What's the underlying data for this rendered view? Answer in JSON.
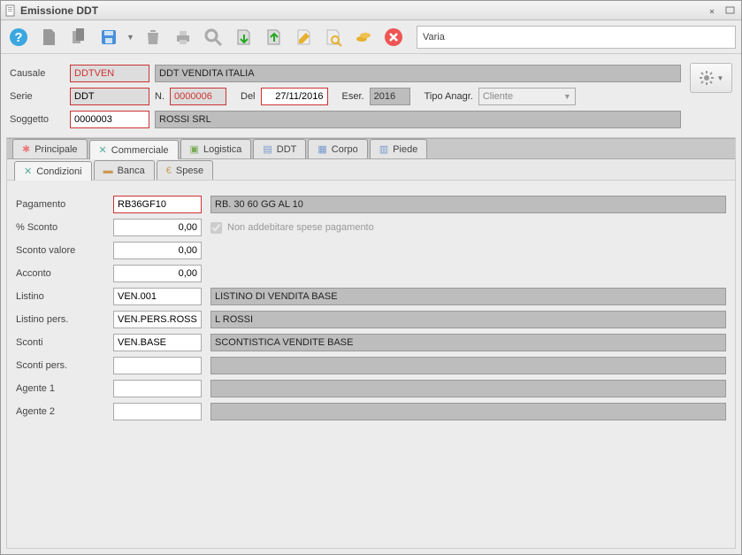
{
  "window": {
    "title": "Emissione DDT"
  },
  "toolbar": {
    "right_text": "Varia"
  },
  "header": {
    "causale_label": "Causale",
    "causale_value": "DDTVEN",
    "causale_desc": "DDT VENDITA ITALIA",
    "serie_label": "Serie",
    "serie_value": "DDT",
    "num_label": "N.",
    "num_value": "0000006",
    "del_label": "Del",
    "del_value": "27/11/2016",
    "eser_label": "Eser.",
    "eser_value": "2016",
    "tipo_label": "Tipo Anagr.",
    "tipo_value": "Cliente",
    "soggetto_label": "Soggetto",
    "soggetto_value": "0000003",
    "soggetto_desc": "ROSSI SRL"
  },
  "tabs": {
    "main": [
      "Principale",
      "Commerciale",
      "Logistica",
      "DDT",
      "Corpo",
      "Piede"
    ],
    "sub": [
      "Condizioni",
      "Banca",
      "Spese"
    ]
  },
  "fields": {
    "pagamento_label": "Pagamento",
    "pagamento_value": "RB36GF10",
    "pagamento_desc": "RB. 30 60 GG AL 10",
    "sconto_pct_label": "% Sconto",
    "sconto_pct_value": "0,00",
    "no_spese_label": "Non addebitare spese pagamento",
    "sconto_val_label": "Sconto valore",
    "sconto_val_value": "0,00",
    "acconto_label": "Acconto",
    "acconto_value": "0,00",
    "listino_label": "Listino",
    "listino_value": "VEN.001",
    "listino_desc": "LISTINO DI VENDITA BASE",
    "listino_pers_label": "Listino pers.",
    "listino_pers_value": "VEN.PERS.ROSS",
    "listino_pers_desc": "L ROSSI",
    "sconti_label": "Sconti",
    "sconti_value": "VEN.BASE",
    "sconti_desc": "SCONTISTICA VENDITE BASE",
    "sconti_pers_label": "Sconti pers.",
    "sconti_pers_value": "",
    "sconti_pers_desc": "",
    "agente1_label": "Agente 1",
    "agente1_value": "",
    "agente1_desc": "",
    "agente2_label": "Agente 2",
    "agente2_value": "",
    "agente2_desc": ""
  }
}
